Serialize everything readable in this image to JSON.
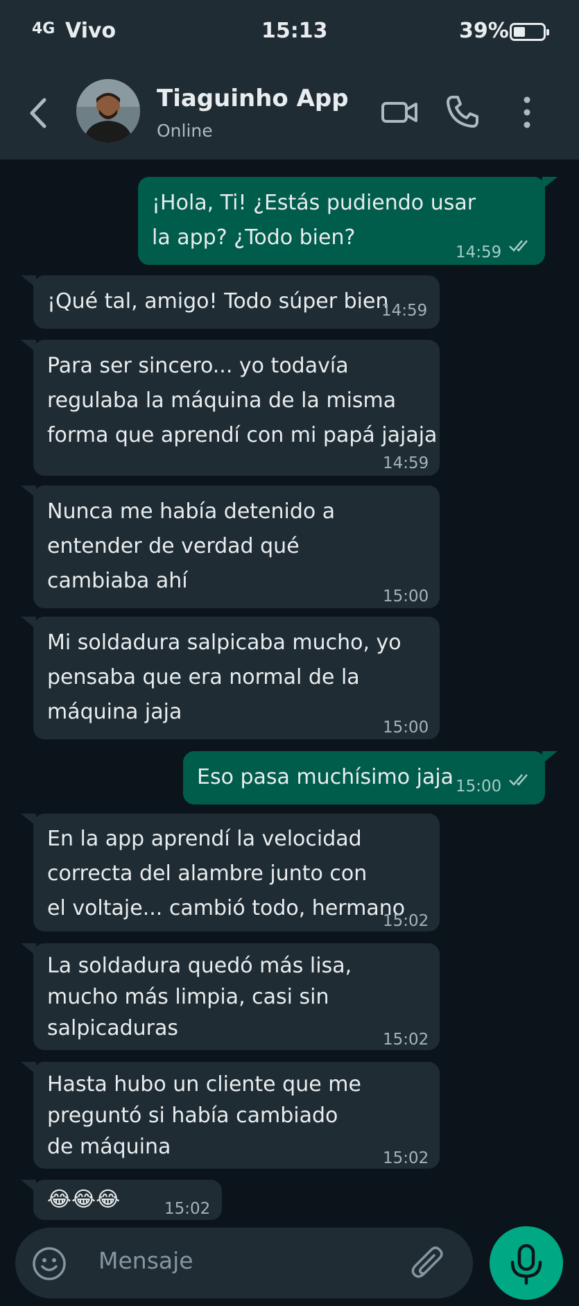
{
  "status_bar": {
    "network": "4G",
    "carrier": "Vivo",
    "time": "15:13",
    "battery": "39%",
    "battery_level": 0.39
  },
  "header": {
    "contact_name": "Tiaguinho App",
    "contact_status": "Online",
    "icons": [
      "back-arrow-icon",
      "video-call-icon",
      "phone-icon",
      "more-vert-icon"
    ]
  },
  "messages": [
    {
      "dir": "out",
      "text": "¡Hola, Ti! ¿Estás pudiendo usar\nla app? ¿Todo bien?",
      "time": "14:59",
      "read": true
    },
    {
      "dir": "in",
      "text": "¡Qué tal, amigo! Todo súper bien",
      "time": "14:59"
    },
    {
      "dir": "in",
      "text": "Para ser sincero... yo todavía\nregulaba la máquina de la misma\nforma que aprendí con mi papá jajaja",
      "time": "14:59"
    },
    {
      "dir": "in",
      "text": "Nunca me había detenido a\nentender de verdad qué\ncambiaba ahí",
      "time": "15:00"
    },
    {
      "dir": "in",
      "text": "Mi soldadura salpicaba mucho, yo\npensaba que era normal de la\nmáquina jaja",
      "time": "15:00"
    },
    {
      "dir": "out",
      "text": "Eso pasa muchísimo jaja",
      "time": "15:00",
      "read": true
    },
    {
      "dir": "in",
      "text": "En la app aprendí la velocidad\ncorrecta del alambre junto con\nel voltaje... cambió todo, hermano",
      "time": "15:02"
    },
    {
      "dir": "in",
      "text": "La soldadura quedó más lisa,\nmucho más limpia, casi sin\nsalpicaduras",
      "time": "15:02"
    },
    {
      "dir": "in",
      "text": "Hasta hubo un cliente que me\npreguntó si había cambiado\nde máquina",
      "time": "15:02"
    },
    {
      "dir": "in",
      "text": "😂😂😂",
      "time": "15:02"
    }
  ],
  "composer": {
    "placeholder": "Mensaje",
    "icons": [
      "emoji-icon",
      "attach-icon",
      "mic-icon"
    ]
  },
  "colors": {
    "background": "#0b141a",
    "header": "#1f2c33",
    "incoming": "#1f2c33",
    "outgoing": "#005c4b",
    "accent": "#00a884"
  }
}
